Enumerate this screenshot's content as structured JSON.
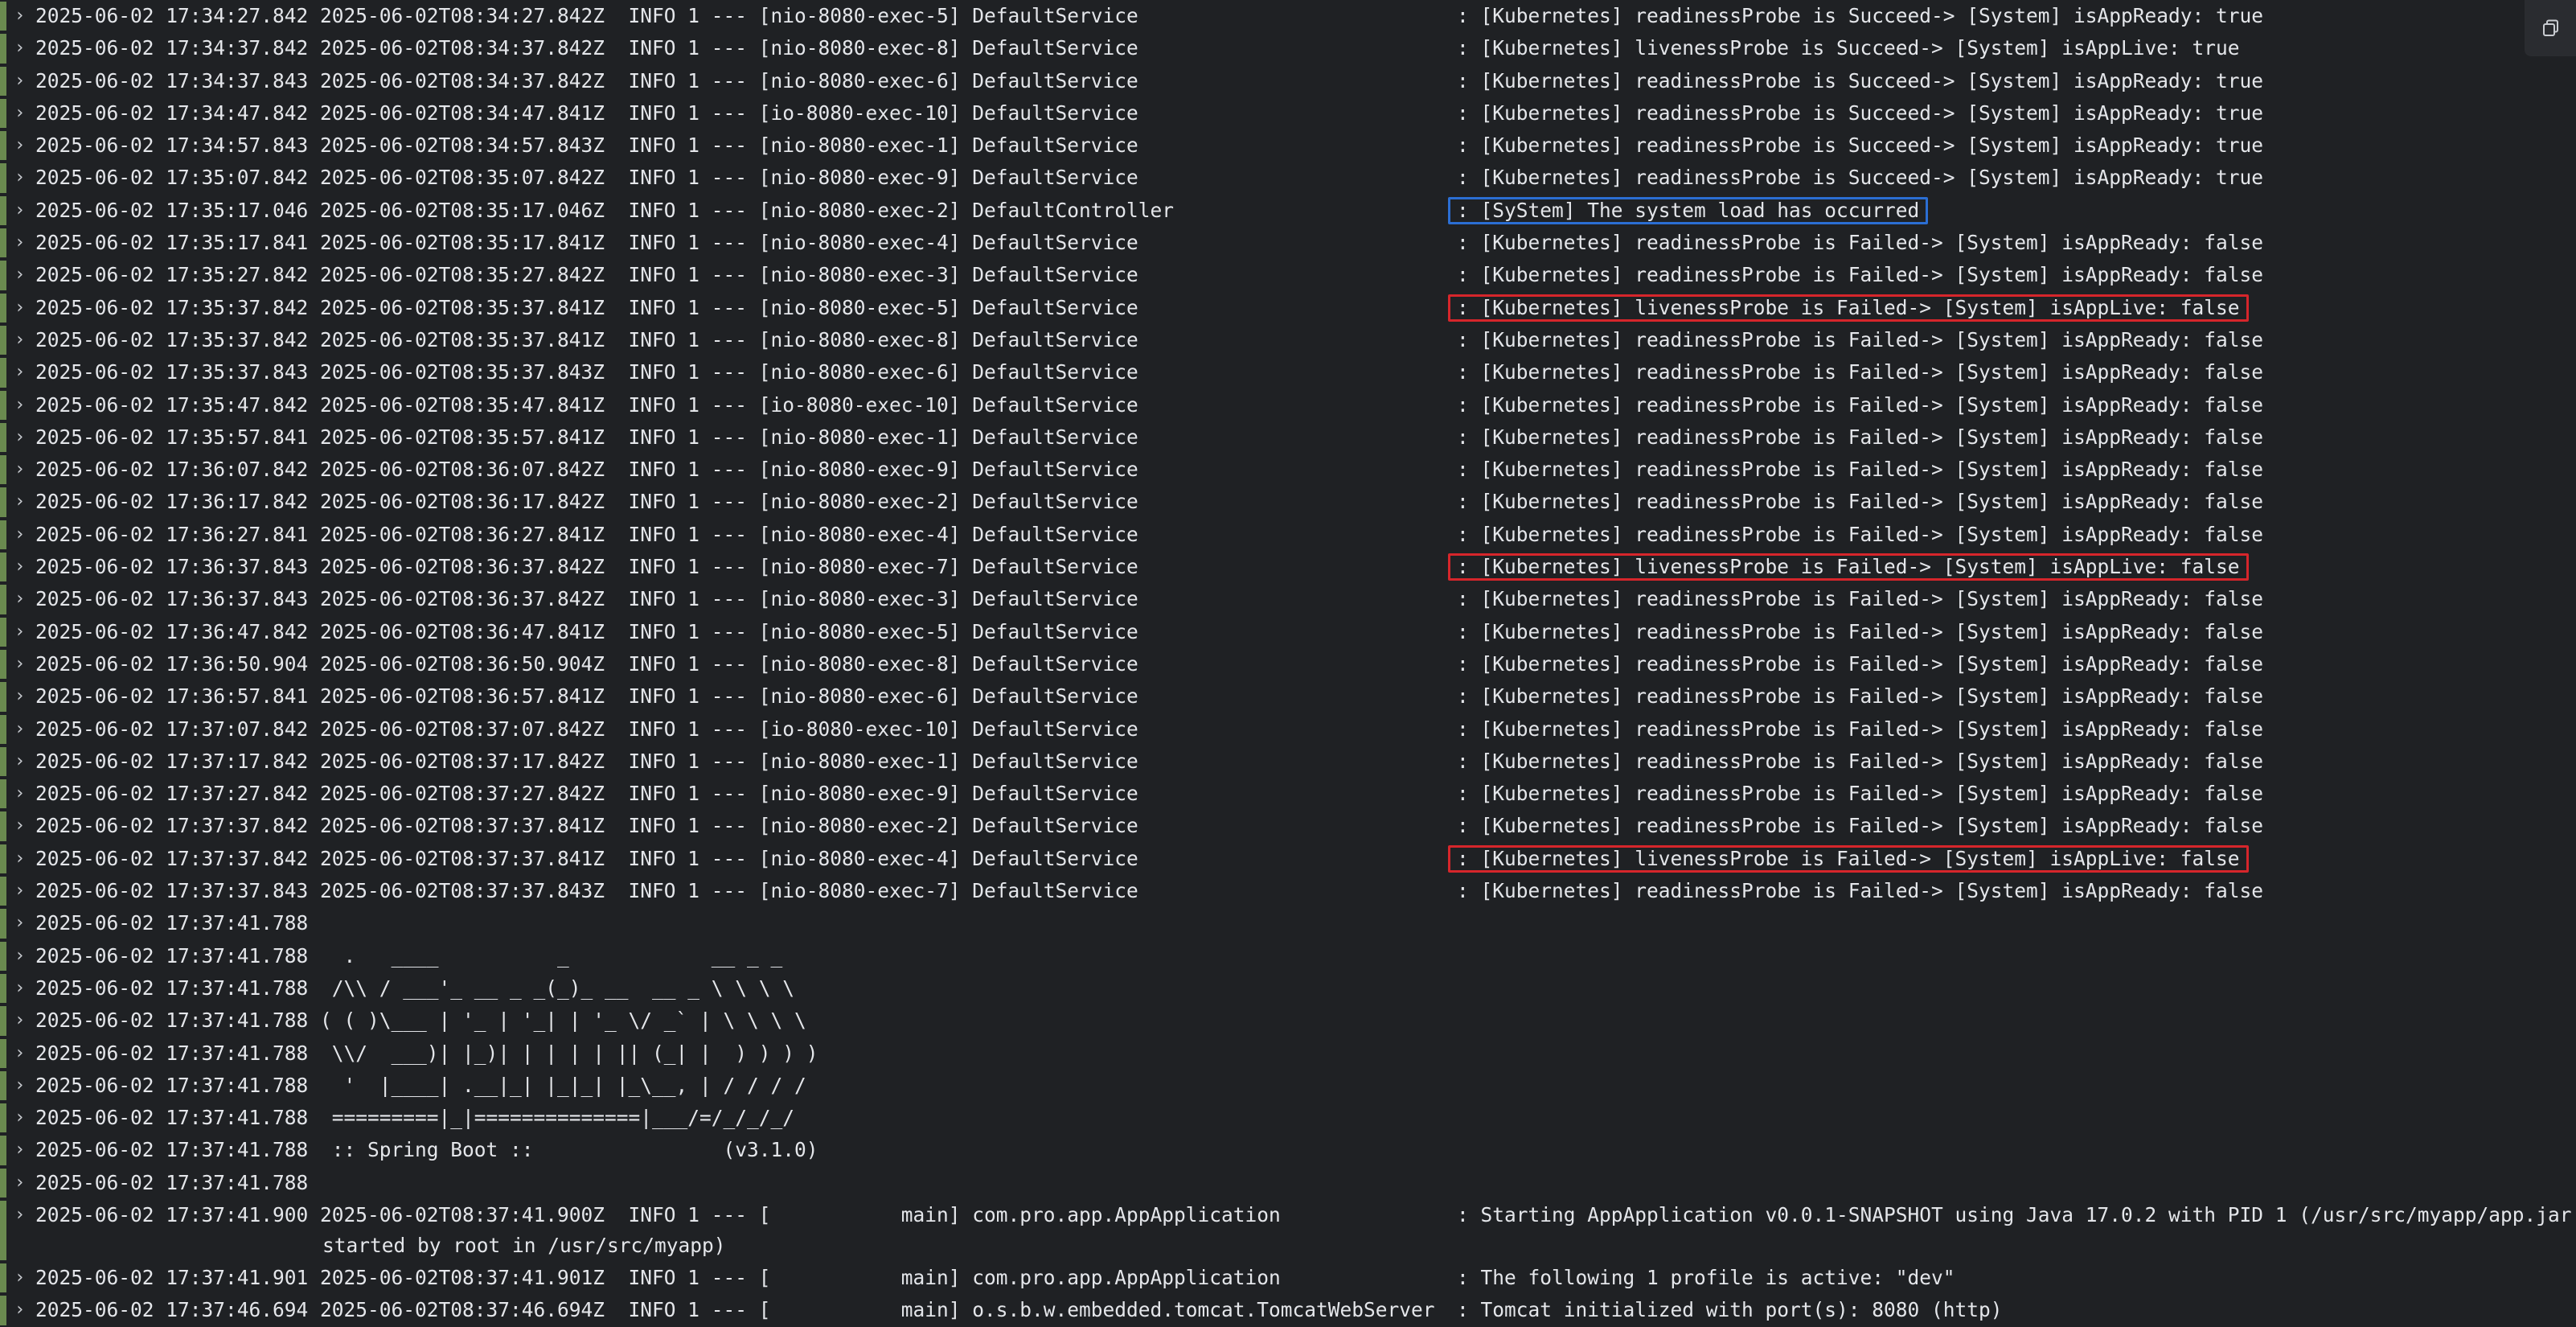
{
  "colors": {
    "background": "#1f2124",
    "text": "#e4e6ea",
    "row_marker": "#6a8a4f",
    "highlight_red": "#d6262b",
    "highlight_blue": "#2b6ed3"
  },
  "toolbar": {
    "copy_icon": "copy-icon"
  },
  "log": {
    "lines": [
      {
        "left": "2025-06-02 17:34:27.842 2025-06-02T08:34:27.842Z  INFO 1 --- [nio-8080-exec-5] DefaultService",
        "msg": ": [Kubernetes] readinessProbe is Succeed-> [System] isAppReady: true"
      },
      {
        "left": "2025-06-02 17:34:37.842 2025-06-02T08:34:37.842Z  INFO 1 --- [nio-8080-exec-8] DefaultService",
        "msg": ": [Kubernetes] livenessProbe is Succeed-> [System] isAppLive: true"
      },
      {
        "left": "2025-06-02 17:34:37.843 2025-06-02T08:34:37.842Z  INFO 1 --- [nio-8080-exec-6] DefaultService",
        "msg": ": [Kubernetes] readinessProbe is Succeed-> [System] isAppReady: true"
      },
      {
        "left": "2025-06-02 17:34:47.842 2025-06-02T08:34:47.841Z  INFO 1 --- [io-8080-exec-10] DefaultService",
        "msg": ": [Kubernetes] readinessProbe is Succeed-> [System] isAppReady: true"
      },
      {
        "left": "2025-06-02 17:34:57.843 2025-06-02T08:34:57.843Z  INFO 1 --- [nio-8080-exec-1] DefaultService",
        "msg": ": [Kubernetes] readinessProbe is Succeed-> [System] isAppReady: true"
      },
      {
        "left": "2025-06-02 17:35:07.842 2025-06-02T08:35:07.842Z  INFO 1 --- [nio-8080-exec-9] DefaultService",
        "msg": ": [Kubernetes] readinessProbe is Succeed-> [System] isAppReady: true"
      },
      {
        "left": "2025-06-02 17:35:17.046 2025-06-02T08:35:17.046Z  INFO 1 --- [nio-8080-exec-2] DefaultController",
        "msg": ": [SyStem] The system load has occurred"
      },
      {
        "left": "2025-06-02 17:35:17.841 2025-06-02T08:35:17.841Z  INFO 1 --- [nio-8080-exec-4] DefaultService",
        "msg": ": [Kubernetes] readinessProbe is Failed-> [System] isAppReady: false"
      },
      {
        "left": "2025-06-02 17:35:27.842 2025-06-02T08:35:27.842Z  INFO 1 --- [nio-8080-exec-3] DefaultService",
        "msg": ": [Kubernetes] readinessProbe is Failed-> [System] isAppReady: false"
      },
      {
        "left": "2025-06-02 17:35:37.842 2025-06-02T08:35:37.841Z  INFO 1 --- [nio-8080-exec-5] DefaultService",
        "msg": ": [Kubernetes] livenessProbe is Failed-> [System] isAppLive: false"
      },
      {
        "left": "2025-06-02 17:35:37.842 2025-06-02T08:35:37.841Z  INFO 1 --- [nio-8080-exec-8] DefaultService",
        "msg": ": [Kubernetes] readinessProbe is Failed-> [System] isAppReady: false"
      },
      {
        "left": "2025-06-02 17:35:37.843 2025-06-02T08:35:37.843Z  INFO 1 --- [nio-8080-exec-6] DefaultService",
        "msg": ": [Kubernetes] readinessProbe is Failed-> [System] isAppReady: false"
      },
      {
        "left": "2025-06-02 17:35:47.842 2025-06-02T08:35:47.841Z  INFO 1 --- [io-8080-exec-10] DefaultService",
        "msg": ": [Kubernetes] readinessProbe is Failed-> [System] isAppReady: false"
      },
      {
        "left": "2025-06-02 17:35:57.841 2025-06-02T08:35:57.841Z  INFO 1 --- [nio-8080-exec-1] DefaultService",
        "msg": ": [Kubernetes] readinessProbe is Failed-> [System] isAppReady: false"
      },
      {
        "left": "2025-06-02 17:36:07.842 2025-06-02T08:36:07.842Z  INFO 1 --- [nio-8080-exec-9] DefaultService",
        "msg": ": [Kubernetes] readinessProbe is Failed-> [System] isAppReady: false"
      },
      {
        "left": "2025-06-02 17:36:17.842 2025-06-02T08:36:17.842Z  INFO 1 --- [nio-8080-exec-2] DefaultService",
        "msg": ": [Kubernetes] readinessProbe is Failed-> [System] isAppReady: false"
      },
      {
        "left": "2025-06-02 17:36:27.841 2025-06-02T08:36:27.841Z  INFO 1 --- [nio-8080-exec-4] DefaultService",
        "msg": ": [Kubernetes] readinessProbe is Failed-> [System] isAppReady: false"
      },
      {
        "left": "2025-06-02 17:36:37.843 2025-06-02T08:36:37.842Z  INFO 1 --- [nio-8080-exec-7] DefaultService",
        "msg": ": [Kubernetes] livenessProbe is Failed-> [System] isAppLive: false"
      },
      {
        "left": "2025-06-02 17:36:37.843 2025-06-02T08:36:37.842Z  INFO 1 --- [nio-8080-exec-3] DefaultService",
        "msg": ": [Kubernetes] readinessProbe is Failed-> [System] isAppReady: false"
      },
      {
        "left": "2025-06-02 17:36:47.842 2025-06-02T08:36:47.841Z  INFO 1 --- [nio-8080-exec-5] DefaultService",
        "msg": ": [Kubernetes] readinessProbe is Failed-> [System] isAppReady: false"
      },
      {
        "left": "2025-06-02 17:36:50.904 2025-06-02T08:36:50.904Z  INFO 1 --- [nio-8080-exec-8] DefaultService",
        "msg": ": [Kubernetes] readinessProbe is Failed-> [System] isAppReady: false"
      },
      {
        "left": "2025-06-02 17:36:57.841 2025-06-02T08:36:57.841Z  INFO 1 --- [nio-8080-exec-6] DefaultService",
        "msg": ": [Kubernetes] readinessProbe is Failed-> [System] isAppReady: false"
      },
      {
        "left": "2025-06-02 17:37:07.842 2025-06-02T08:37:07.842Z  INFO 1 --- [io-8080-exec-10] DefaultService",
        "msg": ": [Kubernetes] readinessProbe is Failed-> [System] isAppReady: false"
      },
      {
        "left": "2025-06-02 17:37:17.842 2025-06-02T08:37:17.842Z  INFO 1 --- [nio-8080-exec-1] DefaultService",
        "msg": ": [Kubernetes] readinessProbe is Failed-> [System] isAppReady: false"
      },
      {
        "left": "2025-06-02 17:37:27.842 2025-06-02T08:37:27.842Z  INFO 1 --- [nio-8080-exec-9] DefaultService",
        "msg": ": [Kubernetes] readinessProbe is Failed-> [System] isAppReady: false"
      },
      {
        "left": "2025-06-02 17:37:37.842 2025-06-02T08:37:37.841Z  INFO 1 --- [nio-8080-exec-2] DefaultService",
        "msg": ": [Kubernetes] readinessProbe is Failed-> [System] isAppReady: false"
      },
      {
        "left": "2025-06-02 17:37:37.842 2025-06-02T08:37:37.841Z  INFO 1 --- [nio-8080-exec-4] DefaultService",
        "msg": ": [Kubernetes] livenessProbe is Failed-> [System] isAppLive: false"
      },
      {
        "left": "2025-06-02 17:37:37.843 2025-06-02T08:37:37.843Z  INFO 1 --- [nio-8080-exec-7] DefaultService",
        "msg": ": [Kubernetes] readinessProbe is Failed-> [System] isAppReady: false"
      },
      {
        "left": "2025-06-02 17:37:41.788",
        "msg": ""
      },
      {
        "left": "2025-06-02 17:37:41.788   .   ____          _            __ _ _",
        "msg": ""
      },
      {
        "left": "2025-06-02 17:37:41.788  /\\\\ / ___'_ __ _ _(_)_ __  __ _ \\ \\ \\ \\",
        "msg": ""
      },
      {
        "left": "2025-06-02 17:37:41.788 ( ( )\\___ | '_ | '_| | '_ \\/ _` | \\ \\ \\ \\",
        "msg": ""
      },
      {
        "left": "2025-06-02 17:37:41.788  \\\\/  ___)| |_)| | | | | || (_| |  ) ) ) )",
        "msg": ""
      },
      {
        "left": "2025-06-02 17:37:41.788   '  |____| .__|_| |_|_| |_\\__, | / / / /",
        "msg": ""
      },
      {
        "left": "2025-06-02 17:37:41.788  =========|_|==============|___/=/_/_/_/",
        "msg": ""
      },
      {
        "left": "2025-06-02 17:37:41.788  :: Spring Boot ::                (v3.1.0)",
        "msg": ""
      },
      {
        "left": "2025-06-02 17:37:41.788",
        "msg": ""
      },
      {
        "left": "2025-06-02 17:37:41.900 2025-06-02T08:37:41.900Z  INFO 1 --- [           main] com.pro.app.AppApplication",
        "msg": ": Starting AppApplication v0.0.1-SNAPSHOT using Java 17.0.2 with PID 1 (/usr/src/myapp/app.jar",
        "cont": "started by root in /usr/src/myapp)"
      },
      {
        "left": "2025-06-02 17:37:41.901 2025-06-02T08:37:41.901Z  INFO 1 --- [           main] com.pro.app.AppApplication",
        "msg": ": The following 1 profile is active: \"dev\""
      },
      {
        "left": "2025-06-02 17:37:46.694 2025-06-02T08:37:46.694Z  INFO 1 --- [           main] o.s.b.w.embedded.tomcat.TomcatWebServer",
        "msg": ": Tomcat initialized with port(s): 8080 (http)"
      }
    ],
    "highlights": [
      {
        "line": 6,
        "color": "blue"
      },
      {
        "line": 9,
        "color": "red"
      },
      {
        "line": 17,
        "color": "red"
      },
      {
        "line": 26,
        "color": "red"
      }
    ]
  }
}
